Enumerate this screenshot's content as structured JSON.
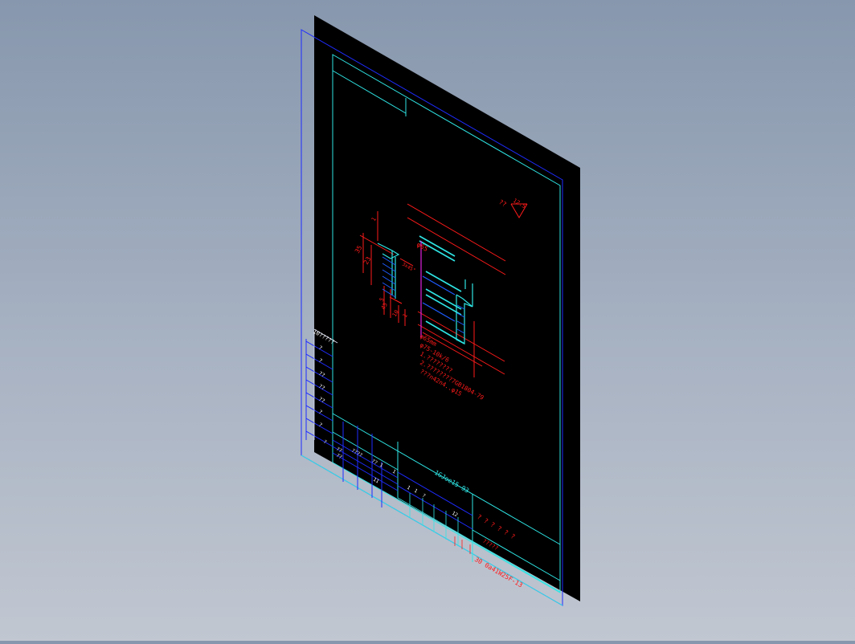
{
  "viewport": {
    "background_top": "#8797ad",
    "background_bottom": "#c1c7d1"
  },
  "colors": {
    "sheet": "#000000",
    "frame_blue": "#1e2cff",
    "frame_cyan": "#2fe5e5",
    "dim_red": "#ff1a1a",
    "centerline_magenta": "#e020e0",
    "text_white": "#ffffff"
  },
  "drawing": {
    "surface_mark": "??",
    "roughness_value": "12.5",
    "dims": {
      "d35": "35",
      "d23": "23",
      "d1": "1",
      "chamfer": "3x45°",
      "d5": "5",
      "d45": "45",
      "d10": "10",
      "d1b": "1",
      "dia": "φ65"
    },
    "notes": [
      "φ65mm",
      "φ75-10k/6",
      "1.????????",
      "2.????????7GB1804-79",
      "???n42n4..φ15"
    ],
    "table_header": "10?????",
    "drawing_number": "30 0a41W25F-13",
    "title_block_cyan": "1GJoe15-93",
    "title_red_label": "? ? ? ? ? ?",
    "title_red_small": "?????",
    "row_labels": [
      "?",
      "?",
      "??",
      "??",
      "??",
      "?",
      "?"
    ],
    "block_texts": [
      "?",
      "??",
      "????",
      "??",
      "??",
      "1",
      "1",
      "1",
      "1",
      "?",
      "11",
      "12"
    ]
  }
}
